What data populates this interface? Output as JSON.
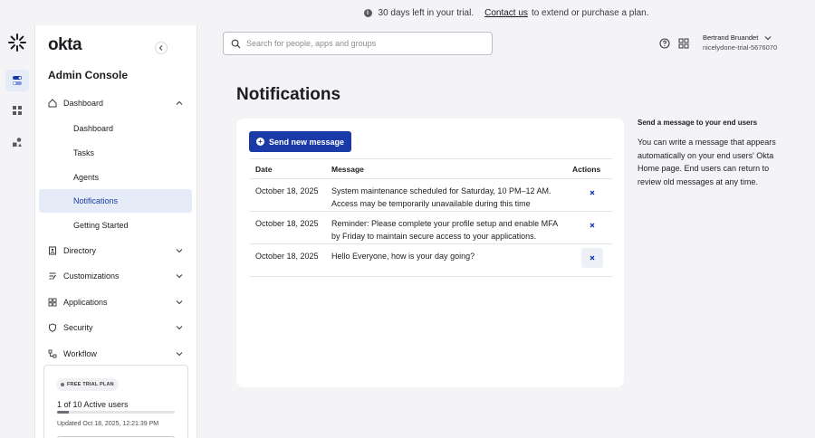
{
  "banner": {
    "days_text": "30 days left in your trial.",
    "contact_link": "Contact us",
    "extend_text": "to extend or purchase a plan."
  },
  "brand": {
    "logo": "okta",
    "console_title": "Admin Console",
    "accent_color": "#1a3aa8"
  },
  "rail": {
    "items": [
      {
        "icon": "dashboard-toggle-icon",
        "active": true
      },
      {
        "icon": "apps-grid-icon",
        "active": false
      },
      {
        "icon": "shapes-icon",
        "active": false
      }
    ]
  },
  "sidebar": {
    "groups": [
      {
        "label": "Dashboard",
        "icon": "home-icon",
        "expanded": true
      },
      {
        "label": "Directory",
        "icon": "directory-icon"
      },
      {
        "label": "Customizations",
        "icon": "customizations-icon"
      },
      {
        "label": "Applications",
        "icon": "applications-icon"
      },
      {
        "label": "Security",
        "icon": "shield-icon"
      },
      {
        "label": "Workflow",
        "icon": "workflow-icon"
      }
    ],
    "dashboard_items": [
      {
        "label": "Dashboard"
      },
      {
        "label": "Tasks"
      },
      {
        "label": "Agents"
      },
      {
        "label": "Notifications",
        "active": true
      },
      {
        "label": "Getting Started"
      }
    ]
  },
  "trial": {
    "badge": "FREE TRIAL PLAN",
    "users": "1 of 10 Active users",
    "progress": 0.1,
    "updated": "Updated Oct 18, 2025, 12:21:39 PM"
  },
  "header": {
    "search_placeholder": "Search for people, apps and groups",
    "user_name": "Bertrand Bruandet",
    "org": "nicelydone-trial-5676070"
  },
  "page": {
    "title": "Notifications",
    "send_button": "Send new message"
  },
  "table": {
    "headers": {
      "date": "Date",
      "message": "Message",
      "actions": "Actions"
    },
    "rows": [
      {
        "date": "October 18, 2025",
        "message": "System maintenance scheduled for Saturday, 10 PM–12 AM. Access may be temporarily unavailable during this time"
      },
      {
        "date": "October 18, 2025",
        "message": "Reminder: Please complete your profile setup and enable MFA by Friday to maintain secure access to your applications."
      },
      {
        "date": "October 18, 2025",
        "message": "Hello Everyone, how is your day going?"
      }
    ]
  },
  "help": {
    "title": "Send a message to your end users",
    "text": "You can write a message that appears automatically on your end users' Okta Home page. End users can return to review old messages at any time."
  }
}
